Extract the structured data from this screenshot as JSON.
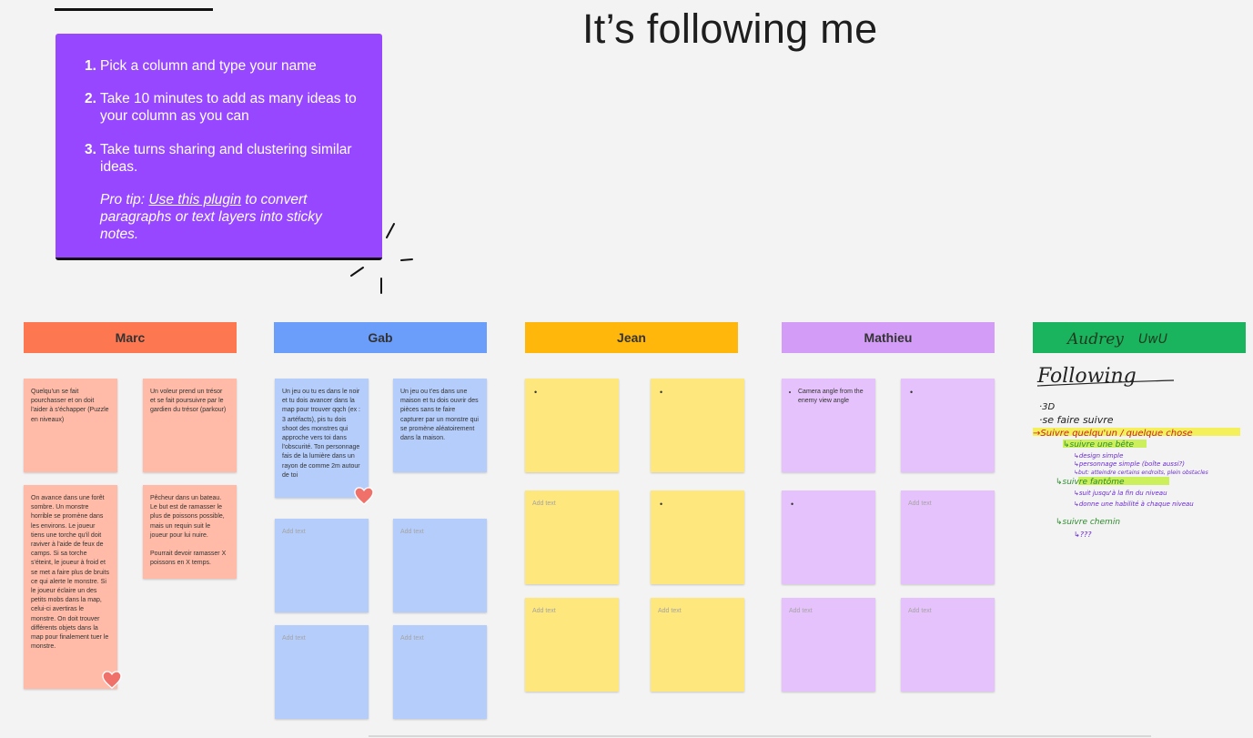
{
  "board": {
    "title": "It’s following me"
  },
  "instructions": {
    "steps": [
      {
        "num": "1.",
        "text": "Pick a column and type your name"
      },
      {
        "num": "2.",
        "text": "Take 10 minutes to add as many ideas to your column as you can"
      },
      {
        "num": "3.",
        "text": "Take turns sharing and clustering similar ideas."
      }
    ],
    "tip_prefix": "Pro tip: ",
    "tip_link": "Use this plugin",
    "tip_suffix": " to convert paragraphs or text layers into sticky notes."
  },
  "columns": [
    {
      "name": "Marc",
      "color": "#fd7751",
      "sticky_color": "#ffbba7"
    },
    {
      "name": "Gab",
      "color": "#6b9dfa",
      "sticky_color": "#b4cdfb"
    },
    {
      "name": "Jean",
      "color": "#ffb70b",
      "sticky_color": "#fee77c"
    },
    {
      "name": "Mathieu",
      "color": "#d39cf7",
      "sticky_color": "#e6c2fc"
    },
    {
      "name": "Audrey",
      "color": "#1bb45e"
    }
  ],
  "stickies": {
    "marc_1": "Quelqu'un se fait pourchasser et on doit l'aider à s'échapper (Puzzle en niveaux)",
    "marc_2": "Un voleur prend un trésor et se fait poursuivre par le gardien du trésor (parkour)",
    "marc_3": "On avance dans une forêt sombre. Un monstre horrible se promène dans les environs. Le joueur tiens une torche qu'il doit raviver à l'aide de feux de camps. Si sa torche s'éteint, le joueur à froid et se met a faire plus de bruits ce qui alerte le monstre. Si le joueur éclaire un des petits mobs dans la map, celui-ci avertiras le monstre. On doit trouver différents objets dans la map pour finalement tuer le monstre.",
    "marc_4a": "Pêcheur dans un bateau. Le but est de ramasser le plus de poissons possible, mais un requin suit le joueur pour lui nuire.",
    "marc_4b": "Pourrait devoir ramasser X poissons en X temps.",
    "gab_1": "Un jeu ou tu es dans le noir et tu dois avancer dans la map pour trouver qqch (ex : 3 artéfacts), pis tu dois shoot des monstres qui approche vers toi dans l'obscurité. Ton personnage fais de la lumière dans un rayon de comme 2m autour de toi",
    "gab_2": "Un jeu ou t'es dans une maison et tu dois ouvrir des pièces sans te faire capturer par un monstre qui se promène aléatoirement dans la maison.",
    "mathieu_1": "Camera angle from the enemy view angle",
    "placeholder": "Add text"
  },
  "audrey_notes": {
    "header": "Audrey",
    "emoticon": "UwU",
    "title": "Following",
    "lines": [
      "·3D",
      "·se faire suivre",
      "→Suivre quelqu'un / quelque chose",
      "↳suivre une bête",
      "↳design simple",
      "↳personnage simple (boîte aussi?)",
      "↳but: atteindre certains endroits, plein obstacles",
      "↳suivre fantôme",
      "↳suit jusqu'à la fin du niveau",
      "↳donne une habilité à chaque niveau",
      "↳suivre chemin",
      "↳???"
    ]
  }
}
